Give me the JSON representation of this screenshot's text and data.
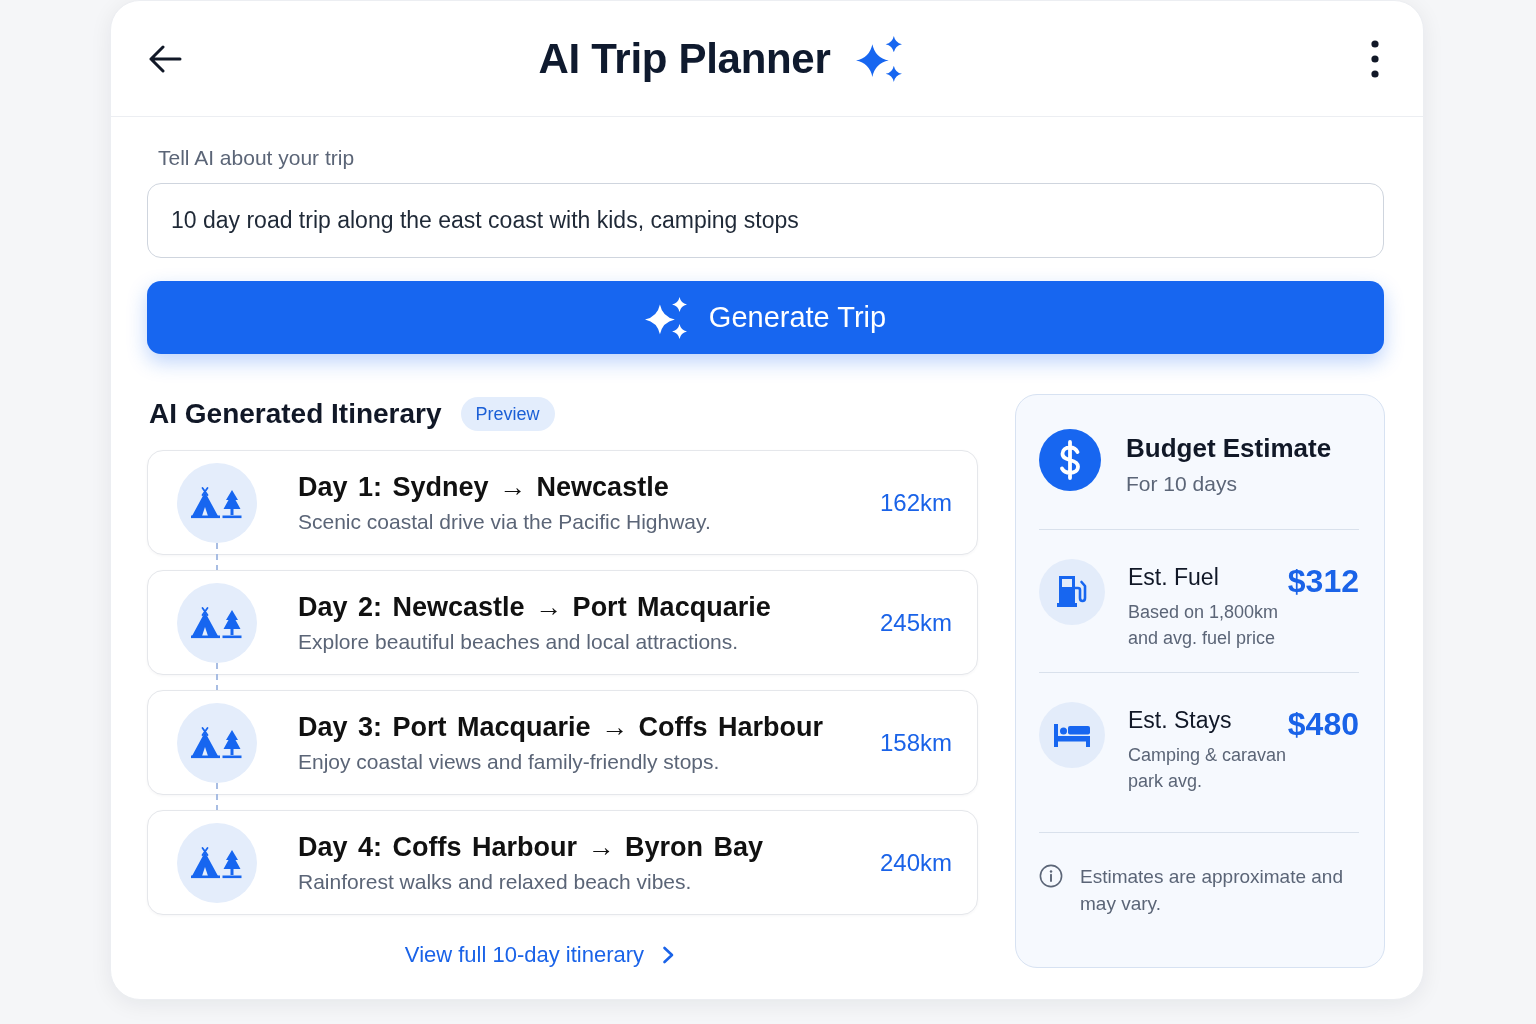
{
  "header": {
    "title": "AI Trip Planner"
  },
  "trip_prompt": {
    "label": "Tell AI about your trip",
    "value": "10 day road trip along the east coast with kids, camping stops"
  },
  "generate_button": {
    "label": "Generate Trip"
  },
  "itinerary": {
    "title": "AI Generated Itinerary",
    "badge": "Preview",
    "days": [
      {
        "title": "Day 1: Sydney → Newcastle",
        "description": "Scenic coastal drive via the Pacific Highway.",
        "distance": "162km"
      },
      {
        "title": "Day 2: Newcastle → Port Macquarie",
        "description": "Explore beautiful beaches and local attractions.",
        "distance": "245km"
      },
      {
        "title": "Day 3: Port Macquarie → Coffs Harbour",
        "description": "Enjoy coastal views and family-friendly stops.",
        "distance": "158km"
      },
      {
        "title": "Day 4: Coffs Harbour → Byron Bay",
        "description": "Rainforest walks and relaxed beach vibes.",
        "distance": "240km"
      }
    ],
    "view_all_link": "View full 10-day itinerary"
  },
  "budget": {
    "title": "Budget Estimate",
    "subtitle": "For 10 days",
    "items": [
      {
        "kind": "fuel",
        "label": "Est. Fuel",
        "amount": "$312",
        "note": "Based on 1,800km and avg. fuel price"
      },
      {
        "kind": "stays",
        "label": "Est. Stays",
        "amount": "$480",
        "note": "Camping & caravan park avg."
      }
    ],
    "disclaimer": "Estimates are approximate and may vary."
  }
}
